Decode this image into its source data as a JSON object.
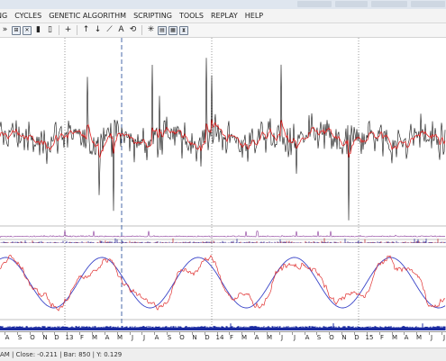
{
  "menu": [
    "NG",
    "CYCLES",
    "GENETIC ALGORITHM",
    "SCRIPTING",
    "TOOLS",
    "REPLAY",
    "HELP"
  ],
  "toolbar": [
    {
      "icon": "fast-forward-icon",
      "glyph": "»"
    },
    {
      "icon": "zoom-in-box-icon",
      "glyph": "⊞"
    },
    {
      "icon": "close-box-icon",
      "glyph": "✕"
    },
    {
      "icon": "battery-icon",
      "glyph": "▮"
    },
    {
      "icon": "clipboard-icon",
      "glyph": "▯"
    },
    {
      "icon": "add-icon",
      "glyph": "+"
    },
    {
      "icon": "arrow-up-icon",
      "glyph": "↑"
    },
    {
      "icon": "arrow-down-icon",
      "glyph": "↓"
    },
    {
      "icon": "pencil-line-icon",
      "glyph": "⟋"
    },
    {
      "icon": "text-annotation-icon",
      "glyph": "A"
    },
    {
      "icon": "refresh-icon",
      "glyph": "⟲"
    },
    {
      "icon": "sun-icon",
      "glyph": "✳"
    },
    {
      "icon": "window-icon",
      "glyph": "▤"
    },
    {
      "icon": "calculator-icon",
      "glyph": "▦"
    },
    {
      "icon": "hourglass-icon",
      "glyph": "⧗"
    }
  ],
  "axis_labels": [
    "A",
    "S",
    "O",
    "N",
    "D",
    "13",
    "F",
    "M",
    "A",
    "M",
    "J",
    "J",
    "A",
    "S",
    "O",
    "N",
    "D",
    "14",
    "F",
    "M",
    "A",
    "M",
    "J",
    "J",
    "A",
    "S",
    "O",
    "N",
    "D",
    "15",
    "F",
    "M",
    "A",
    "M",
    "J",
    "J"
  ],
  "status_text": "AM | Close: -0.211 | Bar: 850 | Y: 0.129",
  "colors": {
    "price": "#111111",
    "average": "#e02020",
    "cycle": "#3a45c8",
    "osc_red": "#e03030",
    "vline": "#4a6aa8"
  },
  "chart_data": {
    "type": "line",
    "panels": [
      "price",
      "average-volume",
      "histogram",
      "cycle-oscillator",
      "volume-bars"
    ]
  }
}
